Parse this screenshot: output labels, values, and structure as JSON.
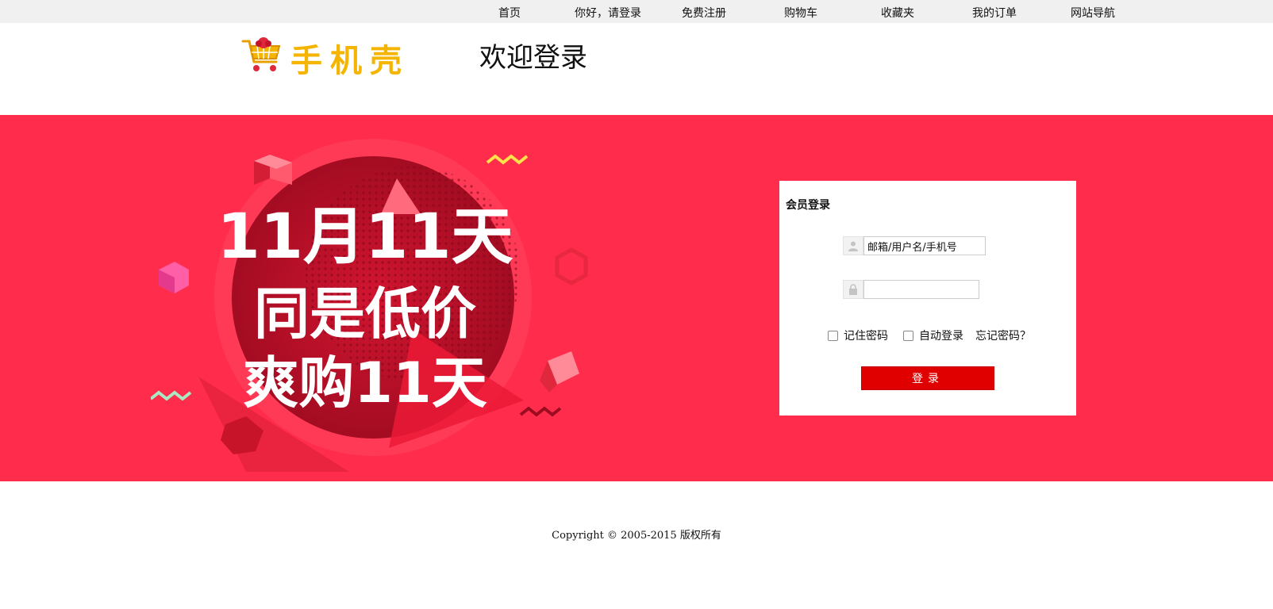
{
  "topnav": {
    "items": [
      "首页",
      "你好，请登录",
      "免费注册",
      "购物车",
      "收藏夹",
      "我的订单",
      "网站导航"
    ]
  },
  "header": {
    "logo_text": "手机壳",
    "welcome": "欢迎登录"
  },
  "banner": {
    "line1": "11月11天",
    "line2": "同是低价",
    "line3": "爽购11天"
  },
  "login": {
    "title": "会员登录",
    "username_value": "邮箱/用户名/手机号",
    "password_value": "",
    "remember_label": "记住密码",
    "autologin_label": "自动登录",
    "forgot_label": "忘记密码？",
    "submit_label": "登录",
    "user_icon": "user-icon",
    "lock_icon": "lock-icon"
  },
  "footer": {
    "copyright": "Copyright © 2005-2015 版权所有"
  },
  "colors": {
    "banner_bg": "#ff2d4b",
    "button": "#e00000",
    "logo": "#f4b400"
  }
}
